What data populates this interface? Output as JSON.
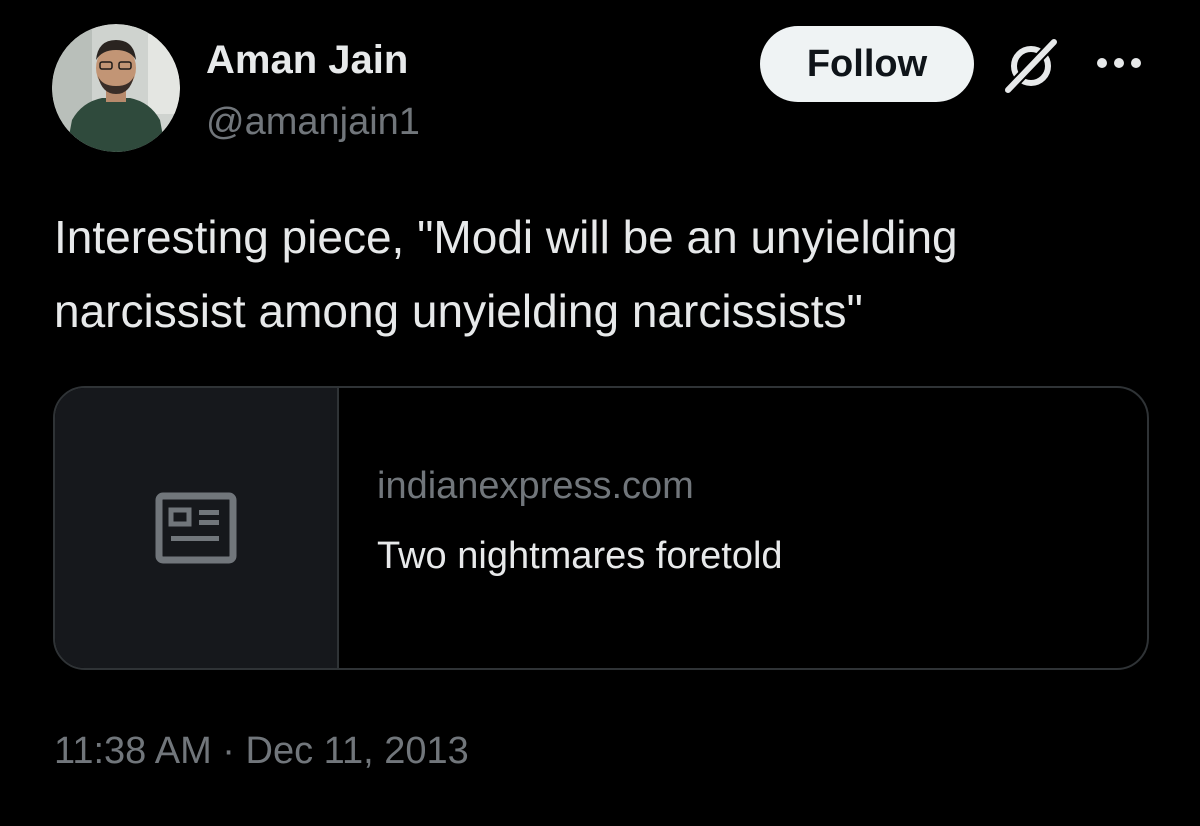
{
  "user": {
    "display_name": "Aman Jain",
    "handle": "@amanjain1"
  },
  "actions": {
    "follow_label": "Follow",
    "grok_icon": "grok-icon",
    "more_icon": "more-icon"
  },
  "tweet": {
    "text": "Interesting piece, \"Modi will be an unyielding\nnarcissist among unyielding narcissists\"",
    "timestamp": "11:38 AM · Dec 11, 2013"
  },
  "link_card": {
    "thumbnail_icon": "newspaper-icon",
    "domain": "indianexpress.com",
    "title": "Two nightmares foretold"
  },
  "colors": {
    "background": "#000000",
    "primary_text": "#e7e9ea",
    "secondary_text": "#71767b",
    "border": "#2f3336",
    "follow_button_bg": "#eff3f4"
  }
}
